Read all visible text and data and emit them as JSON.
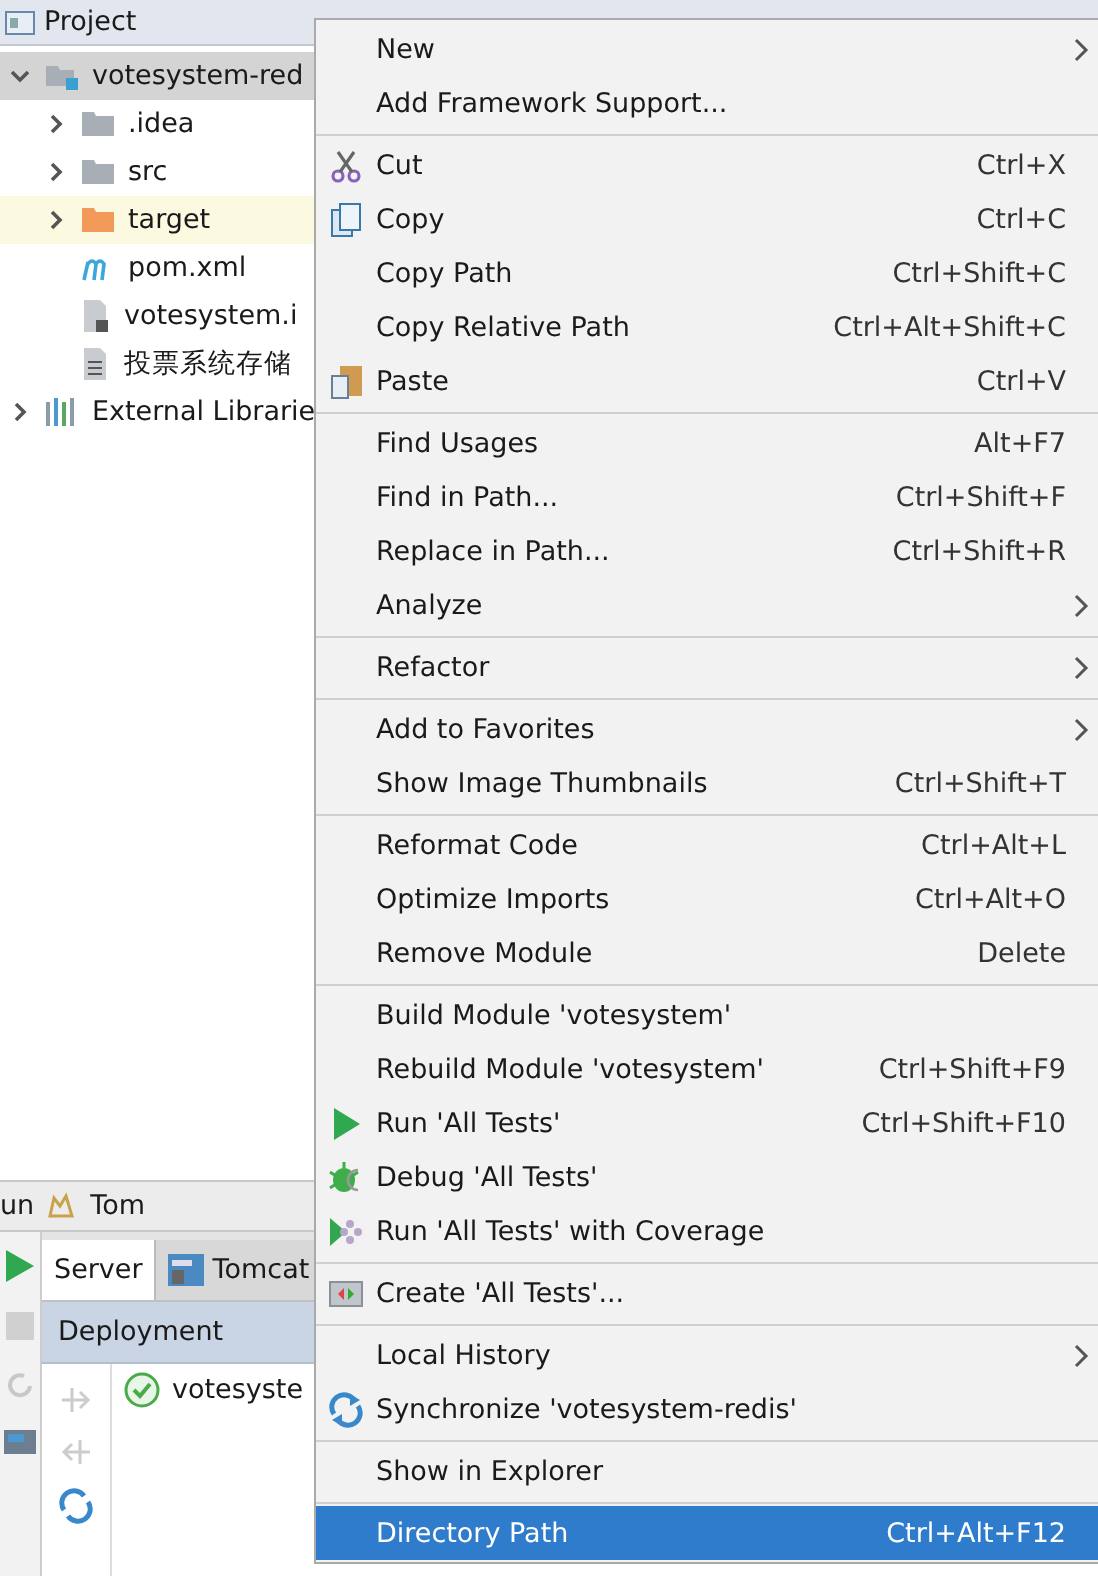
{
  "project_panel": {
    "title": "Project",
    "tree": [
      {
        "label": "votesystem-red",
        "kind": "module",
        "expanded": true,
        "selected": true,
        "children": [
          {
            "label": ".idea",
            "kind": "folder",
            "expanded": false,
            "selected": false
          },
          {
            "label": "src",
            "kind": "folder",
            "expanded": false,
            "selected": false
          },
          {
            "label": "target",
            "kind": "excluded",
            "expanded": false,
            "selected": false
          },
          {
            "label": "pom.xml",
            "kind": "maven",
            "selected": false
          },
          {
            "label": "votesystem.i",
            "kind": "iml",
            "selected": false
          },
          {
            "label": "投票系统存储",
            "kind": "text",
            "selected": false
          }
        ]
      },
      {
        "label": "External Librarie",
        "kind": "library",
        "expanded": false,
        "selected": false
      }
    ]
  },
  "run_panel": {
    "title": "un",
    "tab": "Tom",
    "tabs": [
      {
        "label": "Server",
        "selected": true
      },
      {
        "label": "Tomcat",
        "selected": false
      }
    ],
    "header": "Deployment",
    "deployments": [
      {
        "label": "votesyste",
        "deployed": true
      }
    ]
  },
  "context_menu": {
    "items": [
      {
        "kind": "plain",
        "label": "New",
        "submenu": true,
        "selected": false
      },
      {
        "kind": "plain",
        "label": "Add Framework Support...",
        "submenu": false,
        "selected": false
      },
      {
        "kind": "separator"
      },
      {
        "kind": "cut",
        "label": "Cut",
        "shortcut": "Ctrl+X",
        "submenu": false,
        "selected": false
      },
      {
        "kind": "copy",
        "label": "Copy",
        "shortcut": "Ctrl+C",
        "submenu": false,
        "selected": false
      },
      {
        "kind": "plain",
        "label": "Copy Path",
        "shortcut": "Ctrl+Shift+C",
        "submenu": false,
        "selected": false
      },
      {
        "kind": "plain",
        "label": "Copy Relative Path",
        "shortcut": "Ctrl+Alt+Shift+C",
        "submenu": false,
        "selected": false
      },
      {
        "kind": "paste",
        "label": "Paste",
        "shortcut": "Ctrl+V",
        "submenu": false,
        "selected": false
      },
      {
        "kind": "separator"
      },
      {
        "kind": "plain",
        "label": "Find Usages",
        "shortcut": "Alt+F7",
        "submenu": false,
        "selected": false
      },
      {
        "kind": "plain",
        "label": "Find in Path...",
        "shortcut": "Ctrl+Shift+F",
        "submenu": false,
        "selected": false
      },
      {
        "kind": "plain",
        "label": "Replace in Path...",
        "shortcut": "Ctrl+Shift+R",
        "submenu": false,
        "selected": false
      },
      {
        "kind": "plain",
        "label": "Analyze",
        "submenu": true,
        "selected": false
      },
      {
        "kind": "separator"
      },
      {
        "kind": "plain",
        "label": "Refactor",
        "submenu": true,
        "selected": false
      },
      {
        "kind": "separator"
      },
      {
        "kind": "plain",
        "label": "Add to Favorites",
        "submenu": true,
        "selected": false
      },
      {
        "kind": "plain",
        "label": "Show Image Thumbnails",
        "shortcut": "Ctrl+Shift+T",
        "submenu": false,
        "selected": false
      },
      {
        "kind": "separator"
      },
      {
        "kind": "plain",
        "label": "Reformat Code",
        "shortcut": "Ctrl+Alt+L",
        "submenu": false,
        "selected": false
      },
      {
        "kind": "plain",
        "label": "Optimize Imports",
        "shortcut": "Ctrl+Alt+O",
        "submenu": false,
        "selected": false
      },
      {
        "kind": "plain",
        "label": "Remove Module",
        "shortcut": "Delete",
        "submenu": false,
        "selected": false
      },
      {
        "kind": "separator"
      },
      {
        "kind": "plain",
        "label": "Build Module 'votesystem'",
        "submenu": false,
        "selected": false
      },
      {
        "kind": "plain",
        "label": "Rebuild Module 'votesystem'",
        "shortcut": "Ctrl+Shift+F9",
        "submenu": false,
        "selected": false
      },
      {
        "kind": "run",
        "label": "Run 'All Tests'",
        "shortcut": "Ctrl+Shift+F10",
        "submenu": false,
        "selected": false
      },
      {
        "kind": "debug",
        "label": "Debug 'All Tests'",
        "submenu": false,
        "selected": false
      },
      {
        "kind": "coverage",
        "label": "Run 'All Tests' with Coverage",
        "submenu": false,
        "selected": false
      },
      {
        "kind": "separator"
      },
      {
        "kind": "create",
        "label": "Create 'All Tests'...",
        "submenu": false,
        "selected": false
      },
      {
        "kind": "separator"
      },
      {
        "kind": "plain",
        "label": "Local History",
        "submenu": true,
        "selected": false
      },
      {
        "kind": "sync",
        "label": "Synchronize 'votesystem-redis'",
        "submenu": false,
        "selected": false
      },
      {
        "kind": "separator"
      },
      {
        "kind": "plain",
        "label": "Show in Explorer",
        "submenu": false,
        "selected": false
      },
      {
        "kind": "separator"
      },
      {
        "kind": "plain",
        "label": "Directory Path",
        "shortcut": "Ctrl+Alt+F12",
        "submenu": false,
        "selected": true
      }
    ]
  }
}
